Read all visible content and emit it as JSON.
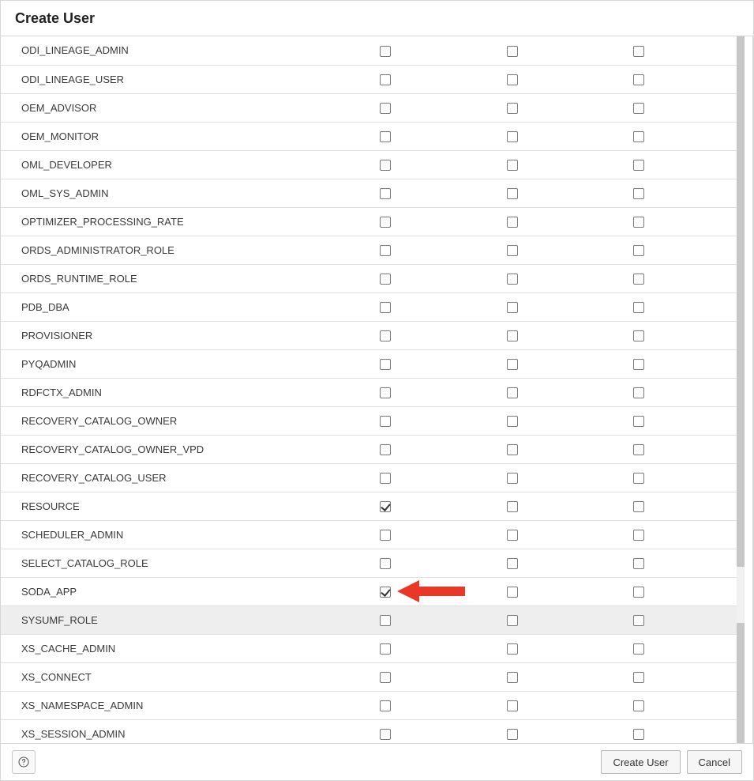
{
  "dialog": {
    "title": "Create User"
  },
  "footer": {
    "help_label": "Help",
    "create_label": "Create User",
    "cancel_label": "Cancel"
  },
  "roles": [
    {
      "name": "ODI_LINEAGE_ADMIN",
      "c1": false,
      "c2": false,
      "c3": false,
      "highlight": false
    },
    {
      "name": "ODI_LINEAGE_USER",
      "c1": false,
      "c2": false,
      "c3": false,
      "highlight": false
    },
    {
      "name": "OEM_ADVISOR",
      "c1": false,
      "c2": false,
      "c3": false,
      "highlight": false
    },
    {
      "name": "OEM_MONITOR",
      "c1": false,
      "c2": false,
      "c3": false,
      "highlight": false
    },
    {
      "name": "OML_DEVELOPER",
      "c1": false,
      "c2": false,
      "c3": false,
      "highlight": false
    },
    {
      "name": "OML_SYS_ADMIN",
      "c1": false,
      "c2": false,
      "c3": false,
      "highlight": false
    },
    {
      "name": "OPTIMIZER_PROCESSING_RATE",
      "c1": false,
      "c2": false,
      "c3": false,
      "highlight": false
    },
    {
      "name": "ORDS_ADMINISTRATOR_ROLE",
      "c1": false,
      "c2": false,
      "c3": false,
      "highlight": false
    },
    {
      "name": "ORDS_RUNTIME_ROLE",
      "c1": false,
      "c2": false,
      "c3": false,
      "highlight": false
    },
    {
      "name": "PDB_DBA",
      "c1": false,
      "c2": false,
      "c3": false,
      "highlight": false
    },
    {
      "name": "PROVISIONER",
      "c1": false,
      "c2": false,
      "c3": false,
      "highlight": false
    },
    {
      "name": "PYQADMIN",
      "c1": false,
      "c2": false,
      "c3": false,
      "highlight": false
    },
    {
      "name": "RDFCTX_ADMIN",
      "c1": false,
      "c2": false,
      "c3": false,
      "highlight": false
    },
    {
      "name": "RECOVERY_CATALOG_OWNER",
      "c1": false,
      "c2": false,
      "c3": false,
      "highlight": false
    },
    {
      "name": "RECOVERY_CATALOG_OWNER_VPD",
      "c1": false,
      "c2": false,
      "c3": false,
      "highlight": false
    },
    {
      "name": "RECOVERY_CATALOG_USER",
      "c1": false,
      "c2": false,
      "c3": false,
      "highlight": false
    },
    {
      "name": "RESOURCE",
      "c1": true,
      "c2": false,
      "c3": false,
      "highlight": false
    },
    {
      "name": "SCHEDULER_ADMIN",
      "c1": false,
      "c2": false,
      "c3": false,
      "highlight": false
    },
    {
      "name": "SELECT_CATALOG_ROLE",
      "c1": false,
      "c2": false,
      "c3": false,
      "highlight": false
    },
    {
      "name": "SODA_APP",
      "c1": true,
      "c2": false,
      "c3": false,
      "highlight": false
    },
    {
      "name": "SYSUMF_ROLE",
      "c1": false,
      "c2": false,
      "c3": false,
      "highlight": true
    },
    {
      "name": "XS_CACHE_ADMIN",
      "c1": false,
      "c2": false,
      "c3": false,
      "highlight": false
    },
    {
      "name": "XS_CONNECT",
      "c1": false,
      "c2": false,
      "c3": false,
      "highlight": false
    },
    {
      "name": "XS_NAMESPACE_ADMIN",
      "c1": false,
      "c2": false,
      "c3": false,
      "highlight": false
    },
    {
      "name": "XS_SESSION_ADMIN",
      "c1": false,
      "c2": false,
      "c3": false,
      "highlight": false
    }
  ],
  "annotation": {
    "arrow_target_role": "SODA_APP",
    "color": "#e73828"
  }
}
